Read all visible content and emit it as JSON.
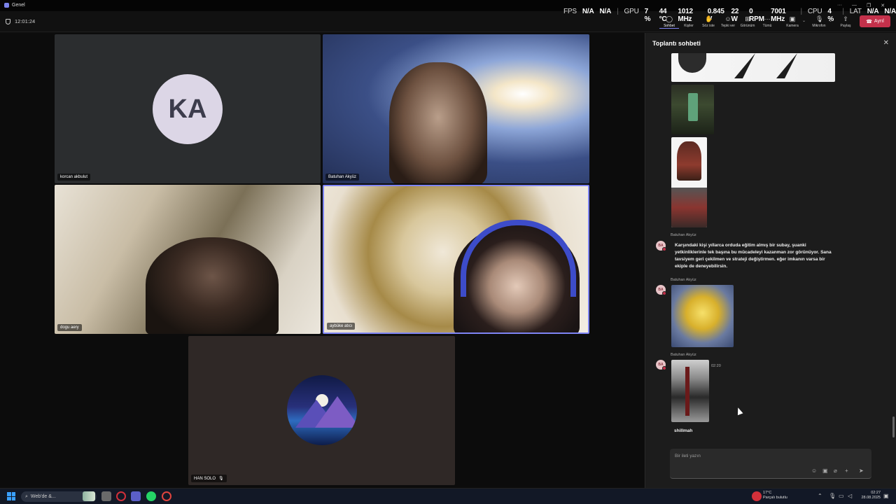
{
  "window": {
    "title": "Genel",
    "minimize": "—",
    "maximize": "❐",
    "close": "✕",
    "more": "···"
  },
  "overlay": {
    "fps_label": "FPS",
    "fps_value": "N/A",
    "fps_value2": "N/A",
    "gpu_label": "GPU",
    "gpu_usage": "7 %",
    "gpu_temp": "44 °C",
    "gpu_clock": "1012 MHz",
    "gpu_voltage": "0.845 V",
    "gpu_power": "22 W",
    "gpu_fan": "0 RPM",
    "gpu_mem_clock": "7001 MHz",
    "cpu_label": "CPU",
    "cpu_usage": "4 %",
    "lat_label": "LAT",
    "lat_value": "N/A",
    "lat_value2": "N/A"
  },
  "meeting": {
    "elapsed": "12:01:24"
  },
  "toolbar": {
    "items": [
      {
        "label": "Sohbet",
        "icon": "chat-icon"
      },
      {
        "label": "Kişiler",
        "icon": "people-icon"
      },
      {
        "label": "Söz iste",
        "icon": "raise-hand-icon"
      },
      {
        "label": "Tepki ver",
        "icon": "emoji-icon"
      },
      {
        "label": "Görünüm",
        "icon": "layout-icon"
      },
      {
        "label": "Tümü",
        "icon": "more-icon"
      },
      {
        "label": "Kamera",
        "icon": "camera-icon"
      },
      {
        "label": "Mikrofon",
        "icon": "microphone-icon"
      },
      {
        "label": "Paylaş",
        "icon": "share-icon"
      }
    ],
    "leave_label": "Ayrıl"
  },
  "participants": [
    {
      "name": "korcan akbulut",
      "initials": "KA"
    },
    {
      "name": "Batuhan Akyüz"
    },
    {
      "name": "dogu aery"
    },
    {
      "name": "aybüke atıcı"
    },
    {
      "name": "HAN SOLO"
    }
  ],
  "chat": {
    "title": "Toplantı sohbeti",
    "messages": [
      {
        "sender": "Batuhan Akyüz",
        "initials": "BA",
        "text": "Karşındaki kişi yıllarca orduda eğitim almış bir subay, şuanki yetkinliklerinle tek başına bu mücadeleyi kazanman zor görünüyor. Sana tavsiyem geri çekilmen ve strateji değiştirmen. eğer imkanın varsa bir ekiple de deneyebilirsin."
      },
      {
        "sender": "Batuhan Akyüz",
        "initials": "BA"
      },
      {
        "sender": "Batuhan Akyüz",
        "initials": "BA",
        "time": "02:20"
      }
    ],
    "own_message": "shillmah",
    "compose_placeholder": "Bir ileti yazın"
  },
  "taskbar": {
    "search_text": "Web'de &...",
    "weather_temp": "17°C",
    "weather_text": "Parçalı bulutlu",
    "time": "02:27",
    "date": "28.08.2025"
  }
}
